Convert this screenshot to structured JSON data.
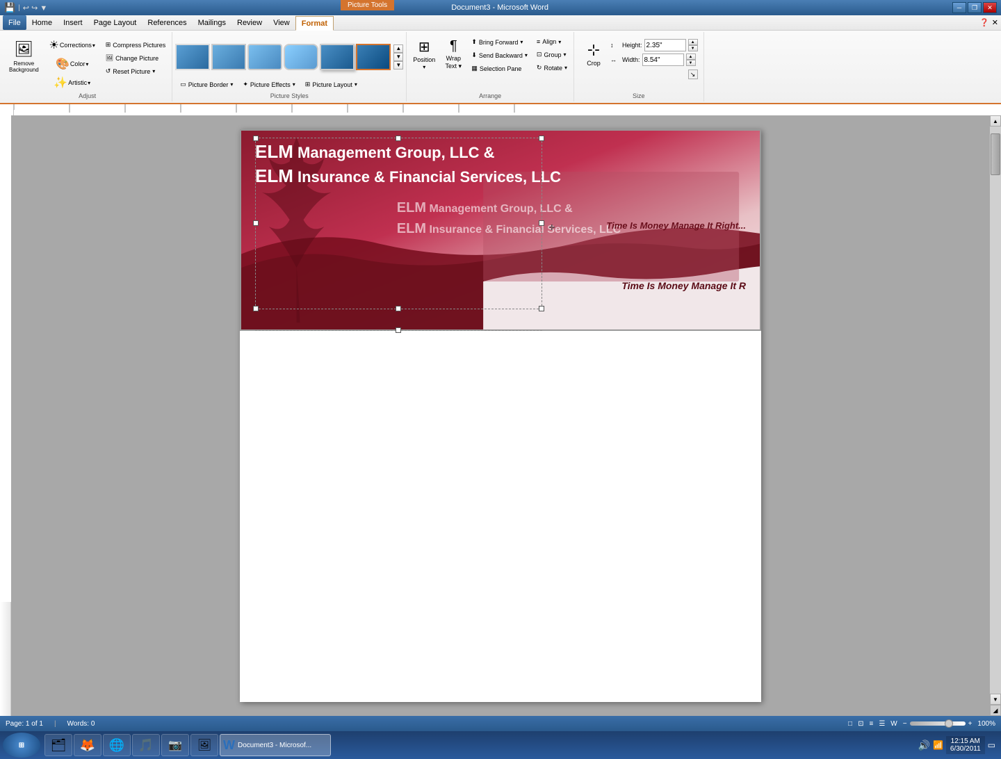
{
  "title_bar": {
    "text": "Document3 - Microsoft Word",
    "picture_tools": "Picture Tools",
    "min": "─",
    "restore": "❐",
    "close": "✕"
  },
  "menu": {
    "items": [
      "File",
      "Home",
      "Insert",
      "Page Layout",
      "References",
      "Mailings",
      "Review",
      "View",
      "Format"
    ],
    "active": "Format"
  },
  "ribbon": {
    "adjust_group": {
      "label": "Adjust",
      "remove_bg": "Remove\nBackground",
      "corrections": "Corrections",
      "color": "Color",
      "artistic_effects": "Artistic\nEffects",
      "compress": "Compress Pictures",
      "change_picture": "Change Picture",
      "reset_picture": "Reset Picture"
    },
    "picture_styles_group": {
      "label": "Picture Styles"
    },
    "arrange_group": {
      "label": "Arrange",
      "position": "Position",
      "wrap_text": "Wrap\nText",
      "bring_forward": "Bring Forward",
      "send_backward": "Send Backward",
      "selection_pane": "Selection Pane",
      "align": "Align",
      "group": "Group",
      "rotate": "Rotate"
    },
    "size_group": {
      "label": "Size",
      "height_label": "Height:",
      "height_value": "2.35\"",
      "width_label": "Width:",
      "width_value": "8.54\"",
      "crop": "Crop"
    },
    "picture_border": "Picture Border",
    "picture_effects": "Picture Effects",
    "picture_layout": "Picture Layout"
  },
  "document": {
    "image": {
      "line1_elm": "ELM",
      "line1_rest": " Management Group, LLC &",
      "line2_elm": "ELM",
      "line2_rest": " Insurance & Financial Services, LLC",
      "mid_elm": "ELM",
      "mid_rest1": " Management Group, LLC &",
      "mid_elm2": "ELM",
      "mid_rest2": " Insurance & Financial Services, LLC",
      "tagline": "Time Is Money Manage It Right...",
      "tagline_bottom": "Time Is Money Manage It R"
    }
  },
  "status_bar": {
    "page": "Page: 1 of 1",
    "words": "Words: 0",
    "zoom": "100%",
    "plus": "+"
  },
  "taskbar": {
    "time": "12:15 AM",
    "date": "6/30/2011",
    "apps": [
      "🗂",
      "🦊",
      "🌐",
      "🎵",
      "📷",
      "🖼",
      "W"
    ]
  }
}
